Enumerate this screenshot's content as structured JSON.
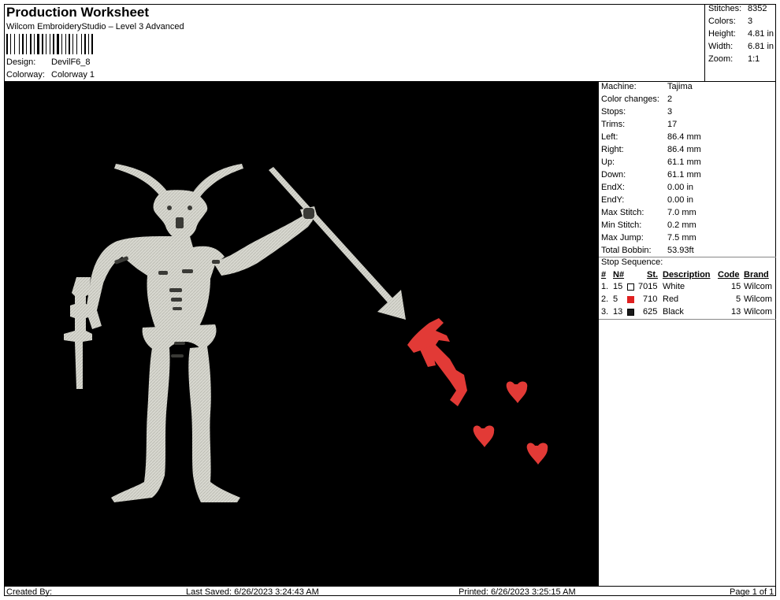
{
  "header": {
    "title": "Production Worksheet",
    "subtitle": "Wilcom EmbroideryStudio – Level 3 Advanced",
    "design_label": "Design:",
    "design_value": "DevilF6_8",
    "colorway_label": "Colorway:",
    "colorway_value": "Colorway 1"
  },
  "summary": [
    {
      "label": "Stitches:",
      "value": "8352"
    },
    {
      "label": "Colors:",
      "value": "3"
    },
    {
      "label": "Height:",
      "value": "4.81 in"
    },
    {
      "label": "Width:",
      "value": "6.81 in"
    },
    {
      "label": "Zoom:",
      "value": "1:1"
    }
  ],
  "machine_info": [
    {
      "label": "Machine:",
      "value": "Tajima"
    },
    {
      "label": "Color changes:",
      "value": "2"
    },
    {
      "label": "Stops:",
      "value": "3"
    },
    {
      "label": "Trims:",
      "value": "17"
    },
    {
      "label": "Left:",
      "value": "86.4 mm"
    },
    {
      "label": "Right:",
      "value": "86.4 mm"
    },
    {
      "label": "Up:",
      "value": "61.1 mm"
    },
    {
      "label": "Down:",
      "value": "61.1 mm"
    },
    {
      "label": "EndX:",
      "value": "0.00 in"
    },
    {
      "label": "EndY:",
      "value": "0.00 in"
    },
    {
      "label": "Max Stitch:",
      "value": "7.0 mm"
    },
    {
      "label": "Min Stitch:",
      "value": "0.2 mm"
    },
    {
      "label": "Max Jump:",
      "value": "7.5 mm"
    },
    {
      "label": "Total Bobbin:",
      "value": "53.93ft"
    }
  ],
  "stop_sequence": {
    "title": "Stop Sequence:",
    "columns": {
      "num": "#",
      "n": "N#",
      "st": "St.",
      "description": "Description",
      "code": "Code",
      "brand": "Brand"
    },
    "rows": [
      {
        "num": "1.",
        "n": "15",
        "st": "7015",
        "description": "White",
        "code": "15",
        "brand": "Wilcom",
        "color": "#ffffff"
      },
      {
        "num": "2.",
        "n": "5",
        "st": "710",
        "description": "Red",
        "code": "5",
        "brand": "Wilcom",
        "color": "#e02020"
      },
      {
        "num": "3.",
        "n": "13",
        "st": "625",
        "description": "Black",
        "code": "13",
        "brand": "Wilcom",
        "color": "#1a1a1a"
      }
    ]
  },
  "footer": {
    "created_by": "Created By:",
    "last_saved": "Last Saved: 6/26/2023 3:24:43 AM",
    "printed": "Printed: 6/26/2023 3:25:15 AM",
    "page": "Page 1 of 1"
  },
  "colors": {
    "background": "#000000",
    "thread_white": "#d9d9d2",
    "thread_red": "#e23a36"
  }
}
